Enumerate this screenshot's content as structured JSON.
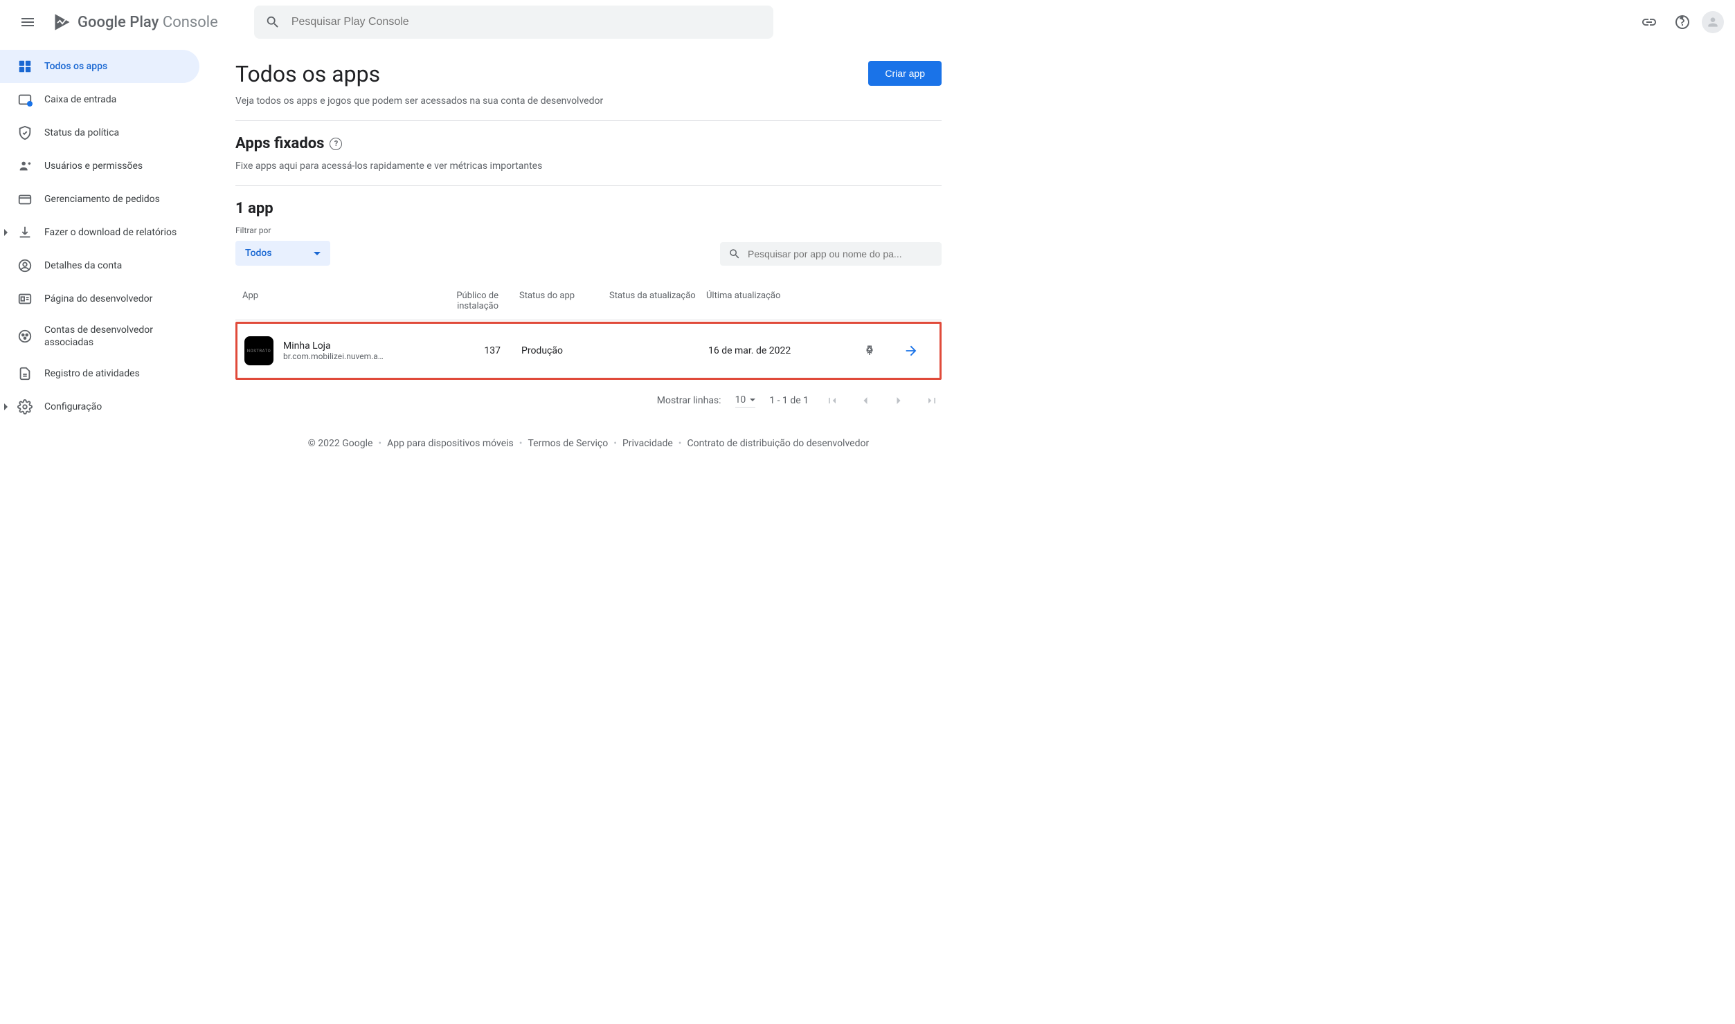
{
  "header": {
    "logo_prefix": "Google Play ",
    "logo_suffix": "Console",
    "search_placeholder": "Pesquisar Play Console"
  },
  "sidebar": {
    "items": [
      {
        "label": "Todos os apps",
        "icon": "apps",
        "active": true
      },
      {
        "label": "Caixa de entrada",
        "icon": "inbox"
      },
      {
        "label": "Status da política",
        "icon": "shield"
      },
      {
        "label": "Usuários e permissões",
        "icon": "users"
      },
      {
        "label": "Gerenciamento de pedidos",
        "icon": "card"
      },
      {
        "label": "Fazer o download de relatórios",
        "icon": "download",
        "expandable": true
      },
      {
        "label": "Detalhes da conta",
        "icon": "account"
      },
      {
        "label": "Página do desenvolvedor",
        "icon": "devpage"
      },
      {
        "label": "Contas de desenvolvedor associadas",
        "icon": "linked"
      },
      {
        "label": "Registro de atividades",
        "icon": "log"
      },
      {
        "label": "Configuração",
        "icon": "settings",
        "expandable": true
      }
    ]
  },
  "page": {
    "title": "Todos os apps",
    "subtitle": "Veja todos os apps e jogos que podem ser acessados na sua conta de desenvolvedor",
    "create_button": "Criar app"
  },
  "pinned": {
    "title": "Apps fixados",
    "subtitle": "Fixe apps aqui para acessá-los rapidamente e ver métricas importantes"
  },
  "apps_section": {
    "title": "1 app",
    "filter_label": "Filtrar por",
    "filter_value": "Todos",
    "search_placeholder": "Pesquisar por app ou nome do pa..."
  },
  "table": {
    "headers": {
      "app": "App",
      "install": "Público de instalação",
      "app_status": "Status do app",
      "update_status": "Status da atualização",
      "last_update": "Última atualização"
    },
    "rows": [
      {
        "name": "Minha Loja",
        "package": "br.com.mobilizei.nuvem.a…",
        "installs": "137",
        "status": "Produção",
        "update_status": "",
        "last_update": "16 de mar. de 2022"
      }
    ]
  },
  "pagination": {
    "rows_label": "Mostrar linhas:",
    "rows_value": "10",
    "range": "1 - 1 de 1"
  },
  "footer": {
    "copyright": "© 2022 Google",
    "links": [
      "App para dispositivos móveis",
      "Termos de Serviço",
      "Privacidade",
      "Contrato de distribuição do desenvolvedor"
    ]
  }
}
